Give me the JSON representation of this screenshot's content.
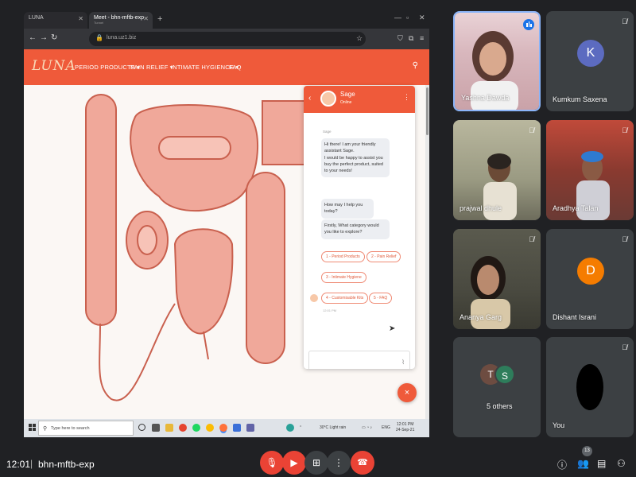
{
  "browser": {
    "tab1_title": "LUNA",
    "tab2_title": "Meet - bhn-mftb-exp",
    "tab2_sub": "Tunnel",
    "url": "luna.uz1.biz"
  },
  "site": {
    "logo": "LUNA",
    "nav": [
      "PERIOD PRODUCTS ▾",
      "PAIN RELIEF ▾",
      "INTIMATE HYGIENCE ▾",
      "FAQ"
    ]
  },
  "chat": {
    "name": "Sage",
    "status": "Online",
    "sender": "Sage",
    "messages": [
      "Hi there! I am your friendly assistant Sage.\nI would be happy to assist you buy the perfect product, suited to your needs!",
      "How may I help you today?",
      "Firstly, What category would you like to explore?"
    ],
    "options": [
      "1 - Period Products",
      "2 - Pain Relief",
      "3 - Intimate Hygiene",
      "4 - Customisable Kits",
      "5 - FAQ"
    ],
    "time": "12:01 PM",
    "close_label": "×"
  },
  "taskbar": {
    "search_placeholder": "Type here to search",
    "weather": "30°C  Light rain",
    "lang": "ENG",
    "clock_time": "12:01 PM",
    "clock_date": "24-Sep-21"
  },
  "participants": [
    {
      "name": "Yashna Dawda",
      "type": "video",
      "speaking": true
    },
    {
      "name": "Kumkum Saxena",
      "type": "avatar",
      "letter": "K",
      "color": "#5c6bc0"
    },
    {
      "name": "prajwal dhule",
      "type": "video"
    },
    {
      "name": "Aradhya Talan",
      "type": "video"
    },
    {
      "name": "Ananya Garg",
      "type": "video"
    },
    {
      "name": "Dishant Israni",
      "type": "avatar",
      "letter": "D",
      "color": "#f57c00"
    },
    {
      "name": "5 others",
      "type": "others",
      "letters": [
        "T",
        "S"
      ]
    },
    {
      "name": "You",
      "type": "self"
    }
  ],
  "meeting": {
    "time": "12:01",
    "separator": "|",
    "code": "bhn-mftb-exp",
    "participant_count": "13"
  },
  "colors": {
    "brand": "#ef5a3a",
    "meet_bg": "#202124",
    "tile_bg": "#3c4043",
    "danger": "#ea4335"
  }
}
